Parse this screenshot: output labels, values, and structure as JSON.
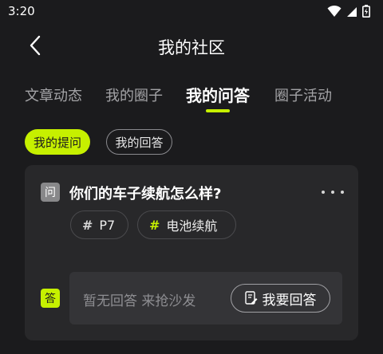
{
  "status_bar": {
    "time": "3:20",
    "icons": [
      "wifi-icon",
      "signal-icon",
      "battery-icon"
    ]
  },
  "header": {
    "title": "我的社区",
    "back_icon": "back-arrow-icon"
  },
  "tabs": [
    {
      "label": "文章动态",
      "active": false
    },
    {
      "label": "我的圈子",
      "active": false
    },
    {
      "label": "我的问答",
      "active": true
    },
    {
      "label": "圈子活动",
      "active": false
    }
  ],
  "filters": {
    "asked_label": "我的提问",
    "answered_label": "我的回答"
  },
  "question_card": {
    "q_badge": "问",
    "title": "你们的车子续航怎么样?",
    "tags": [
      {
        "hash": "#",
        "label": "P7"
      },
      {
        "hash": "#",
        "label": "电池续航"
      }
    ],
    "a_badge": "答",
    "answer_placeholder": "暂无回答 来抢沙发",
    "answer_button_label": "我要回答",
    "answer_button_icon": "edit-note-icon"
  },
  "colors": {
    "background": "#1b1b1d",
    "card": "#28282a",
    "accent": "#c6f000",
    "muted_text": "#a3a3a6"
  }
}
